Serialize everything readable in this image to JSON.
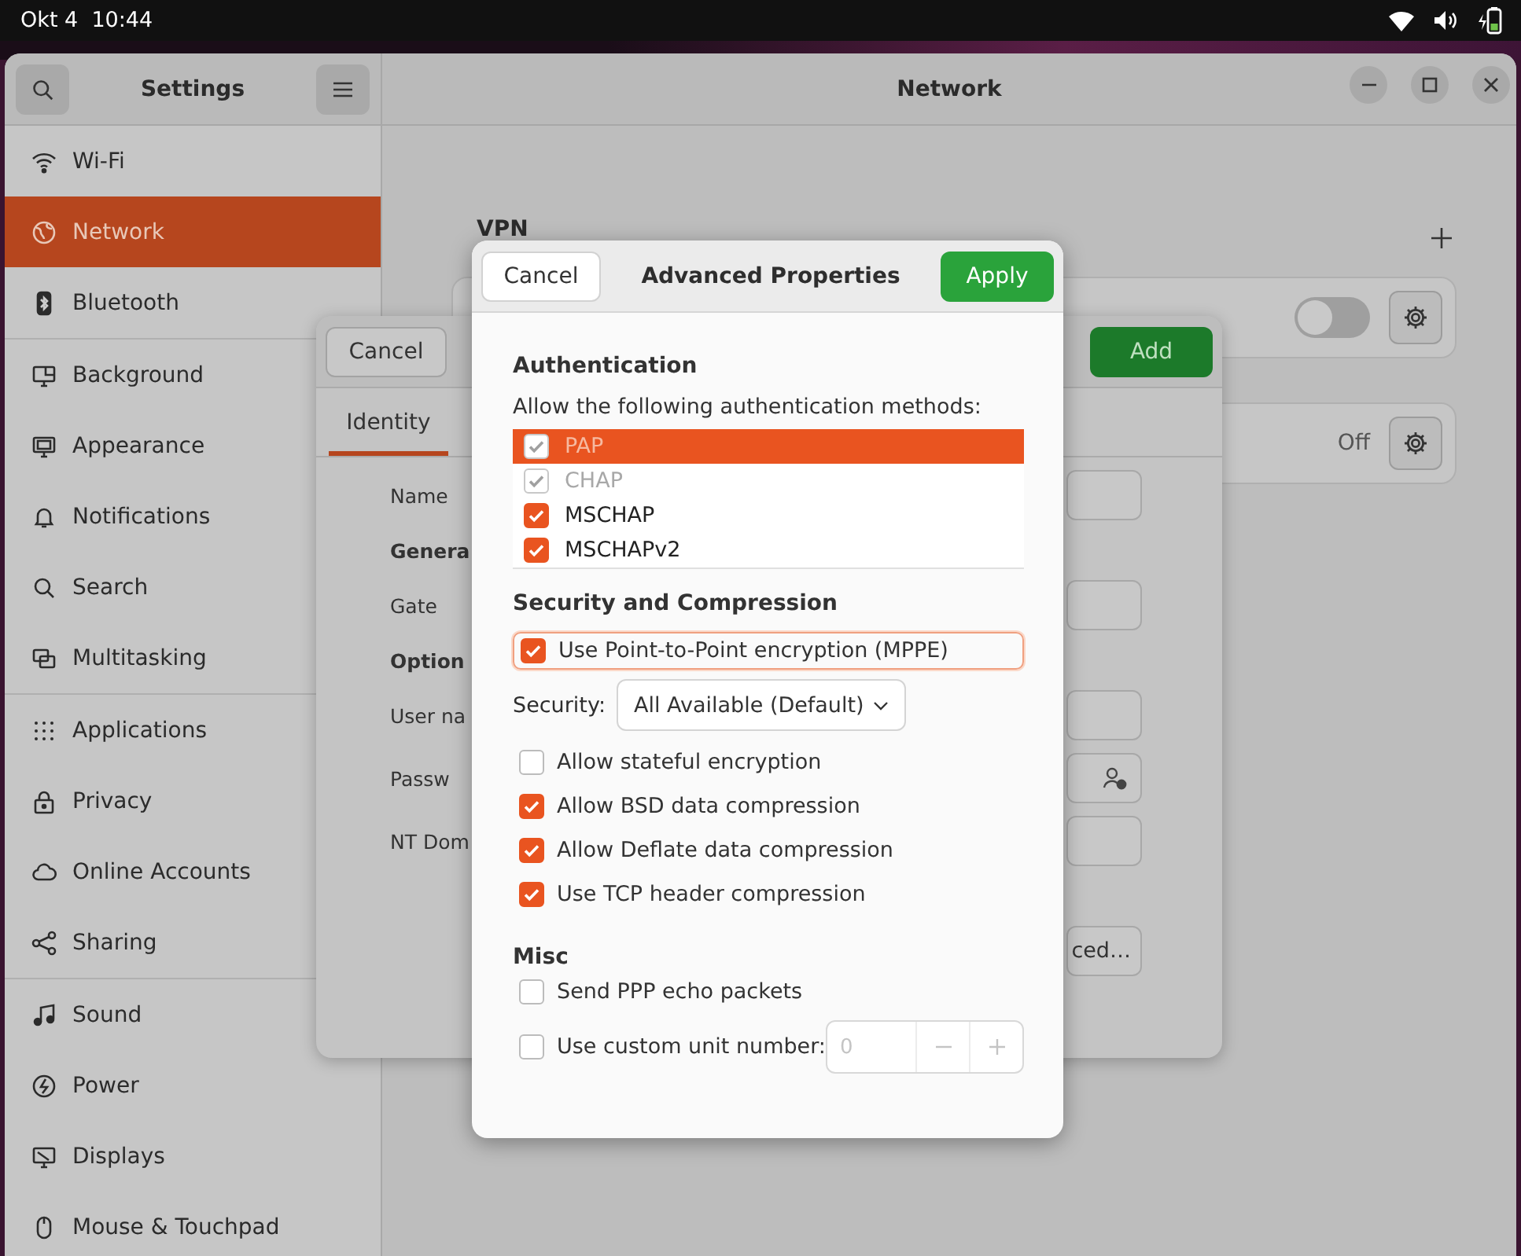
{
  "status_bar": {
    "date": "Okt 4",
    "time": "10:44"
  },
  "window": {
    "sidebar_title": "Settings",
    "title": "Network"
  },
  "sidebar": {
    "groups": [
      [
        {
          "label": "Wi-Fi",
          "selected": false
        },
        {
          "label": "Network",
          "selected": true
        },
        {
          "label": "Bluetooth",
          "selected": false
        }
      ],
      [
        {
          "label": "Background",
          "selected": false
        },
        {
          "label": "Appearance",
          "selected": false
        },
        {
          "label": "Notifications",
          "selected": false
        },
        {
          "label": "Search",
          "selected": false
        },
        {
          "label": "Multitasking",
          "selected": false
        }
      ],
      [
        {
          "label": "Applications",
          "selected": false
        },
        {
          "label": "Privacy",
          "selected": false
        },
        {
          "label": "Online Accounts",
          "selected": false
        },
        {
          "label": "Sharing",
          "selected": false
        }
      ],
      [
        {
          "label": "Sound",
          "selected": false
        },
        {
          "label": "Power",
          "selected": false
        },
        {
          "label": "Displays",
          "selected": false
        },
        {
          "label": "Mouse & Touchpad",
          "selected": false
        }
      ]
    ]
  },
  "vpn": {
    "heading": "VPN",
    "rows": [
      {
        "kind": "switch",
        "on": false
      },
      {
        "kind": "status",
        "status": "Off"
      }
    ]
  },
  "connection_dialog": {
    "cancel": "Cancel",
    "add": "Add",
    "tabs": [
      {
        "label": "Identity",
        "selected": true
      }
    ],
    "rows": [
      {
        "kind": "field",
        "label": "Name"
      },
      {
        "kind": "heading",
        "label": "Genera"
      },
      {
        "kind": "field",
        "label": "Gate"
      },
      {
        "kind": "heading",
        "label": "Option"
      },
      {
        "kind": "field",
        "label": "User na"
      },
      {
        "kind": "password",
        "label": "Passw"
      },
      {
        "kind": "field",
        "label": "NT Dom"
      },
      {
        "kind": "button",
        "label": "ced…"
      }
    ]
  },
  "advanced_dialog": {
    "cancel": "Cancel",
    "title": "Advanced Properties",
    "apply": "Apply",
    "auth_heading": "Authentication",
    "auth_hint": "Allow the following authentication methods:",
    "auth_methods": [
      {
        "label": "PAP",
        "checked": true,
        "selected": true,
        "disabled": true
      },
      {
        "label": "CHAP",
        "checked": true,
        "selected": false,
        "disabled": true
      },
      {
        "label": "MSCHAP",
        "checked": true,
        "selected": false,
        "disabled": false
      },
      {
        "label": "MSCHAPv2",
        "checked": true,
        "selected": false,
        "disabled": false
      }
    ],
    "security_heading": "Security and Compression",
    "mppe": {
      "label": "Use Point-to-Point encryption (MPPE)",
      "checked": true,
      "focused": true
    },
    "security": {
      "label": "Security:",
      "value": "All Available (Default)"
    },
    "options": [
      {
        "label": "Allow stateful encryption",
        "checked": false
      },
      {
        "label": "Allow BSD data compression",
        "checked": true
      },
      {
        "label": "Allow Deflate data compression",
        "checked": true
      },
      {
        "label": "Use TCP header compression",
        "checked": true
      }
    ],
    "misc_heading": "Misc",
    "echo": {
      "label": "Send PPP echo packets",
      "checked": false
    },
    "unit": {
      "label": "Use custom unit number:",
      "checked": false,
      "value": "0"
    }
  }
}
